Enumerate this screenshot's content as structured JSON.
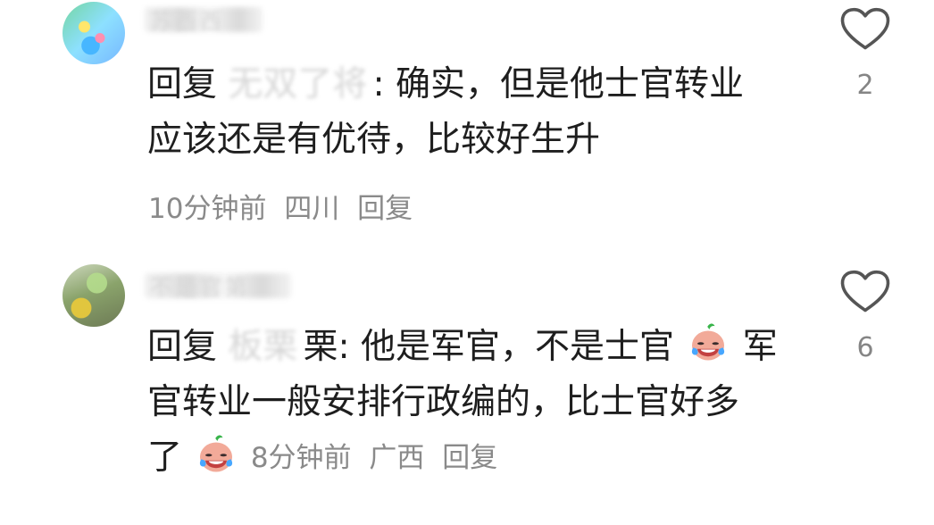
{
  "comments": [
    {
      "username_blurred": "苏西西",
      "reply_prefix": "回复",
      "reply_user_blurred": "无双了将",
      "reply_separator": ":",
      "line1_rest": " 确实，但是他士官转业",
      "line2": "应该还是有优待，比较好生升",
      "time": "10分钟前",
      "location": "四川",
      "reply_label": "回复",
      "likes": "2"
    },
    {
      "username_blurred": "不是官第",
      "reply_prefix": "回复",
      "reply_user_blurred": "板栗",
      "reply_separator": "栗:",
      "line1_a": " 他是军官，不是士官",
      "line1_b": "军",
      "line2": "官转业一般安排行政编的，比士官好多",
      "line3_start": "了",
      "time": "8分钟前",
      "location": "广西",
      "reply_label": "回复",
      "likes": "6"
    }
  ],
  "icons": {
    "heart": "heart-icon",
    "avatar1": "avatar",
    "avatar2": "avatar",
    "emoji": "crying-laughing-face-icon"
  },
  "colors": {
    "text": "#1e1e1e",
    "meta": "#8a8a8a",
    "like": "#858585",
    "heart": "#555555"
  }
}
